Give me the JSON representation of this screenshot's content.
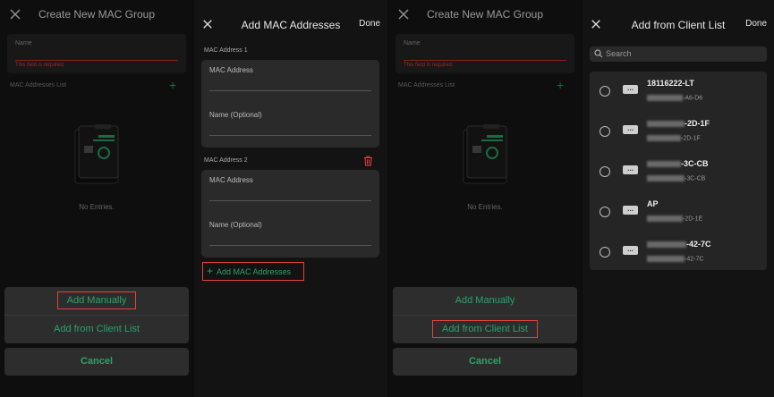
{
  "panel1": {
    "title": "Create New MAC Group",
    "name_label": "Name",
    "name_error": "This field is required.",
    "list_label": "MAC Addresses List",
    "no_entries": "No Entries.",
    "action_add_manually": "Add Manually",
    "action_add_from_client": "Add from Client List",
    "cancel": "Cancel"
  },
  "panel2": {
    "title": "Add MAC Addresses",
    "done": "Done",
    "entries": [
      {
        "section": "MAC Address 1",
        "mac_placeholder": "MAC Address",
        "name_placeholder": "Name (Optional)"
      },
      {
        "section": "MAC Address 2",
        "mac_placeholder": "MAC Address",
        "name_placeholder": "Name (Optional)"
      }
    ],
    "add_button": "Add MAC Addresses"
  },
  "panel3": {
    "title": "Create New MAC Group",
    "name_label": "Name",
    "name_error": "This field is required.",
    "list_label": "MAC Addresses List",
    "no_entries": "No Entries.",
    "action_add_manually": "Add Manually",
    "action_add_from_client": "Add from Client List",
    "cancel": "Cancel"
  },
  "panel4": {
    "title": "Add from Client List",
    "done": "Done",
    "search_placeholder": "Search",
    "clients": [
      {
        "name": "18116222-LT",
        "mac_suffix": "-A6-D6"
      },
      {
        "name": "-2D-1F",
        "mac_suffix": "-2D-1F"
      },
      {
        "name": "-3C-CB",
        "mac_suffix": "-3C-CB"
      },
      {
        "name": "AP",
        "mac_suffix": "-2D-1E"
      },
      {
        "name": "-42-7C",
        "mac_suffix": "-42-7C"
      }
    ]
  },
  "colors": {
    "accent": "#2aa36b",
    "error": "#e2463f",
    "highlight": "#e0443a"
  }
}
